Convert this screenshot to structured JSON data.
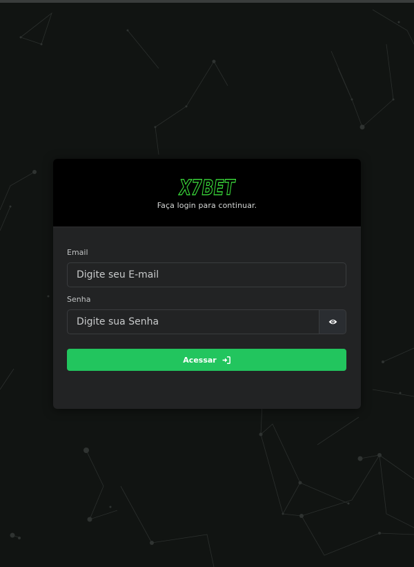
{
  "brand": {
    "logo_text": "X7BET",
    "subtitle": "Faça login para continuar."
  },
  "form": {
    "email_label": "Email",
    "email_placeholder": "Digite seu E-mail",
    "password_label": "Senha",
    "password_placeholder": "Digite sua Senha",
    "submit_label": "Acessar"
  },
  "icons": {
    "toggle_password": "eye-icon",
    "submit": "sign-in-icon"
  },
  "colors": {
    "background": "#111412",
    "card": "#222324",
    "card_header": "#000000",
    "logo": "#3ee83e",
    "accent": "#22c55e"
  }
}
